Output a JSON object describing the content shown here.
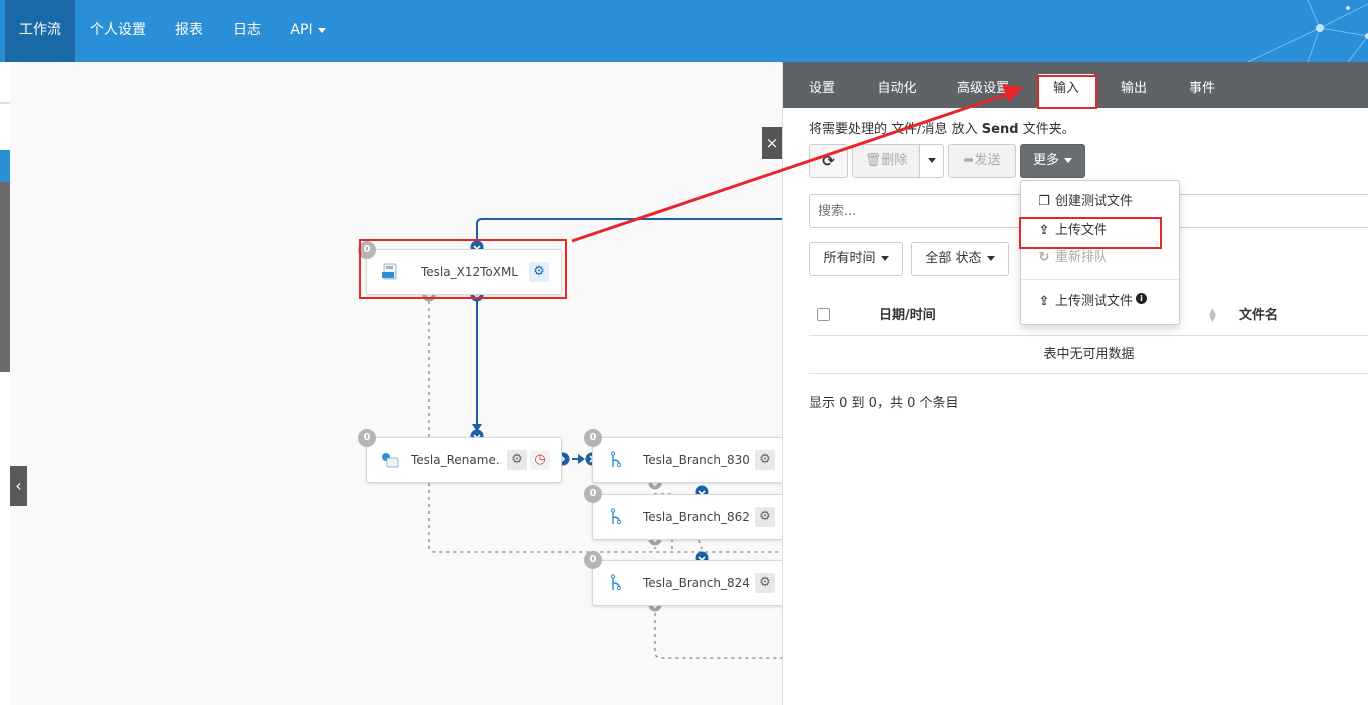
{
  "nav": {
    "items": [
      {
        "label": "工作流",
        "active": true
      },
      {
        "label": "个人设置"
      },
      {
        "label": "报表"
      },
      {
        "label": "日志"
      },
      {
        "label": "API"
      }
    ]
  },
  "canvas": {
    "collapse_icon": "chevron-left-icon",
    "close_label": "×",
    "nodes": [
      {
        "name": "Tesla_X12ToXML",
        "count": "0",
        "icon": "x12-connector-icon"
      },
      {
        "name": "Tesla_Rename...",
        "count": "0",
        "icon": "rename-connector-icon"
      },
      {
        "name": "Tesla_Branch_830",
        "count": "0",
        "icon": "branch-icon"
      },
      {
        "name": "Tesla_Branch_862",
        "count": "0",
        "icon": "branch-icon"
      },
      {
        "name": "Tesla_Branch_824",
        "count": "0",
        "icon": "branch-icon"
      }
    ]
  },
  "panel": {
    "tabs": [
      {
        "label": "设置"
      },
      {
        "label": "自动化"
      },
      {
        "label": "高级设置"
      },
      {
        "label": "输入",
        "active": true
      },
      {
        "label": "输出"
      },
      {
        "label": "事件"
      }
    ],
    "hint_prefix": "将需要处理的 文件/消息 放入",
    "hint_folder": "Send",
    "hint_suffix": "文件夹。",
    "toolbar": {
      "refresh_icon": "refresh-icon",
      "delete_label": "删除",
      "send_label": "发送",
      "more_label": "更多"
    },
    "search_placeholder": "搜索...",
    "filters": {
      "time_label": "所有时间",
      "status_label": "全部 状态"
    },
    "table": {
      "columns": [
        "日期/时间",
        "文件名"
      ],
      "empty_text": "表中无可用数据"
    },
    "info_text": "显示 0 到 0，共 0 个条目",
    "more_menu": [
      {
        "label": "创建测试文件",
        "icon": "copy-icon"
      },
      {
        "label": "上传文件",
        "icon": "upload-icon",
        "highlighted": true
      },
      {
        "label": "重新排队",
        "icon": "requeue-icon",
        "disabled": true
      },
      {
        "label": "上传测试文件",
        "icon": "upload-icon",
        "has_info": true
      }
    ]
  },
  "colors": {
    "nav_bg": "#2a8fd6",
    "nav_active": "#1a6aa8",
    "tab_bar": "#5f6266",
    "annotation_red": "#e8262a",
    "connector_blue": "#1d5fa3"
  }
}
